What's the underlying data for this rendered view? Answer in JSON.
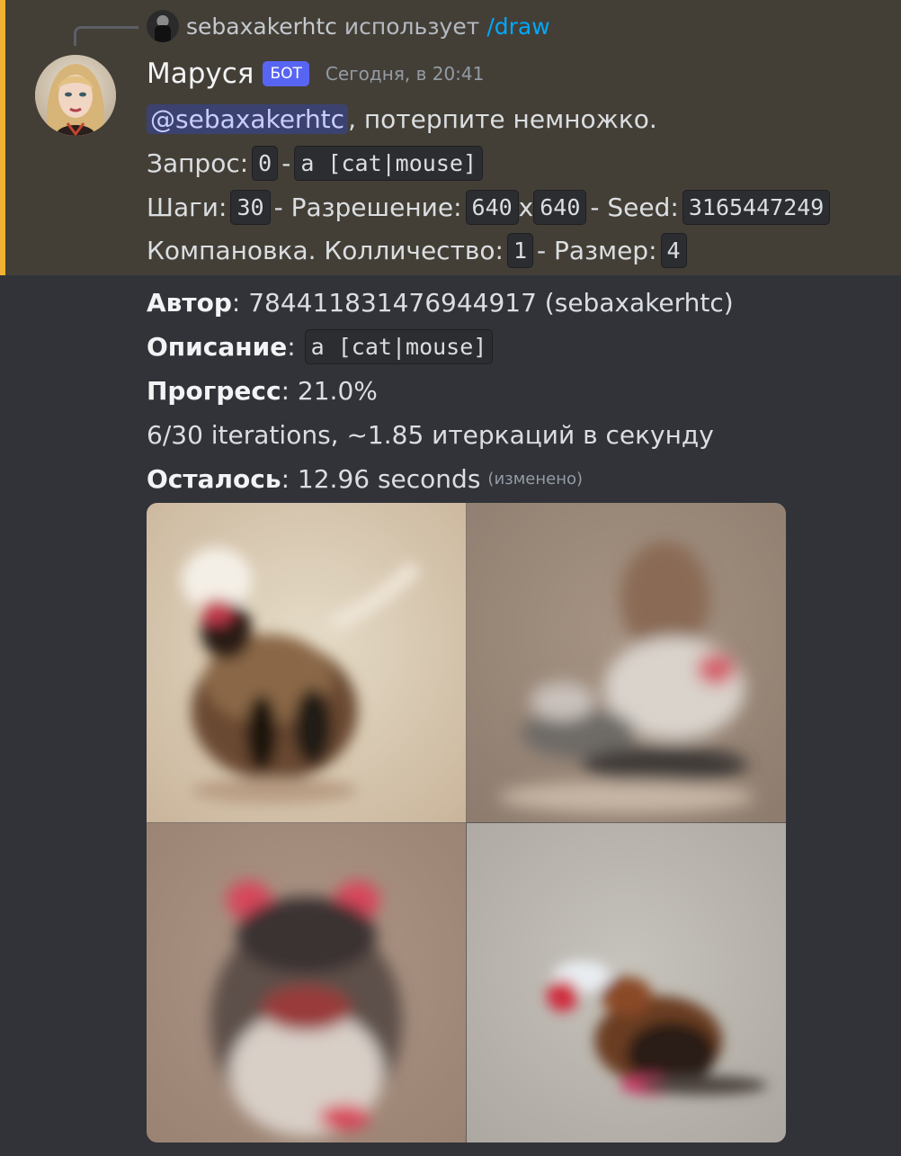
{
  "reply": {
    "username": "sebaxakerhtc",
    "action_text": "использует",
    "command": "/draw"
  },
  "message": {
    "author": "Маруся",
    "bot_tag": "БОТ",
    "timestamp": "Сегодня, в 20:41",
    "mention": "@sebaxakerhtc",
    "greeting": ", потерпите немножко.",
    "request_label": "Запрос:",
    "request_index": "0",
    "request_sep": "-",
    "request_prompt": "a [cat|mouse]",
    "steps_label": "Шаги:",
    "steps_value": "30",
    "resolution_label": "- Разрешение:",
    "res_width": "640",
    "res_x": "x",
    "res_height": "640",
    "seed_label": "- Seed:",
    "seed_value": "3165447249",
    "layout_label": "Компановка. Колличество:",
    "count_value": "1",
    "size_label": "- Размер:",
    "size_value": "4"
  },
  "progress": {
    "author_label": "Автор",
    "author_value": ": 784411831476944917 (sebaxakerhtc)",
    "desc_label": "Описание",
    "desc_sep": ":",
    "desc_value": "a [cat|mouse]",
    "progress_label": "Прогресс",
    "progress_value": ": 21.0%",
    "iterations_text": "6/30 iterations, ~1.85 итеркаций в секунду",
    "remaining_label": "Осталось",
    "remaining_value": ": 12.96 seconds",
    "edited": "(изменено)"
  },
  "colors": {
    "background": "#313338",
    "highlight": "#433f37",
    "highlight_bar": "#f0b232",
    "bot_tag": "#5865f2",
    "command_link": "#00a8fc"
  },
  "icons": {
    "reply_avatar": "user-avatar-icon",
    "bot_avatar": "bot-avatar-icon"
  }
}
